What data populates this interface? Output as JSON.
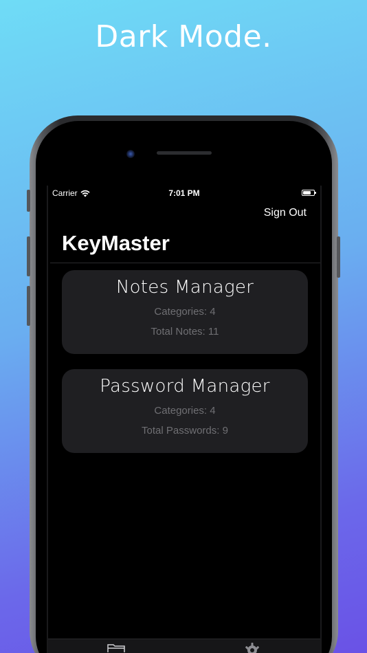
{
  "headline": "Dark Mode.",
  "status_bar": {
    "carrier": "Carrier",
    "time": "7:01 PM",
    "battery_level": 0.7,
    "icons": [
      "wifi-icon",
      "battery-icon"
    ]
  },
  "nav": {
    "sign_out_label": "Sign Out",
    "title": "KeyMaster"
  },
  "cards": [
    {
      "title": "Notes Manager",
      "line1": "Categories: 4",
      "line2": "Total Notes: 11"
    },
    {
      "title": "Password Manager",
      "line1": "Categories: 4",
      "line2": "Total Passwords: 9"
    }
  ],
  "tab_bar": {
    "icons": [
      "folder-icon",
      "gear-icon"
    ]
  },
  "colors": {
    "background_gradient": [
      "#6fdcf6",
      "#6a52e6"
    ],
    "card_background": "#1f1f22",
    "card_secondary_text": "#6f6f73",
    "screen_background": "#000000"
  }
}
